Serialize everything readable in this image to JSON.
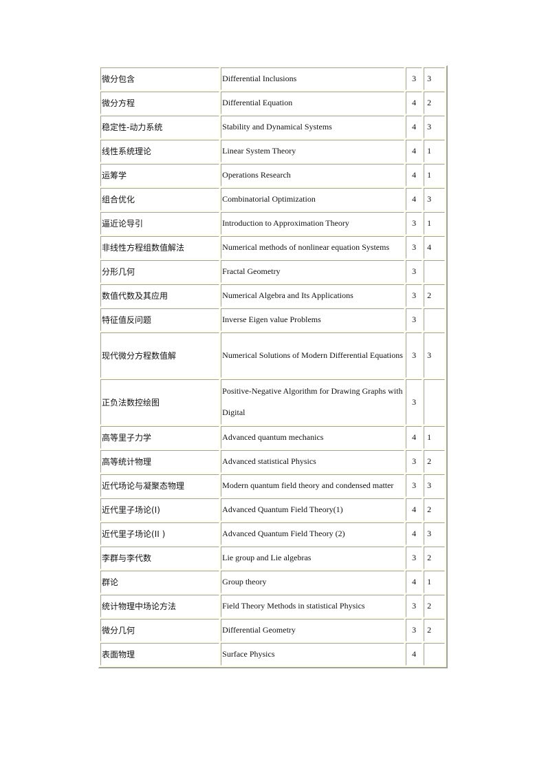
{
  "table": {
    "rows": [
      {
        "cn": "微分包含",
        "en": "Differential  Inclusions",
        "a": "3",
        "b": "3"
      },
      {
        "cn": "微分方程",
        "en": "Differential  Equation",
        "a": "4",
        "b": "2"
      },
      {
        "cn": "稳定性-动力系统",
        "en": "Stability and Dynamical  Systems",
        "a": "4",
        "b": "3"
      },
      {
        "cn": "线性系统理论",
        "en": "Linear  System  Theory",
        "a": "4",
        "b": "1"
      },
      {
        "cn": "运筹学",
        "en": "Operations  Research",
        "a": "4",
        "b": "1"
      },
      {
        "cn": "组合优化",
        "en": "Combinatorial  Optimization",
        "a": "4",
        "b": "3"
      },
      {
        "cn": "逼近论导引",
        "en": "Introduction  to  Approximation  Theory",
        "a": "3",
        "b": "1"
      },
      {
        "cn": "非线性方程组数值解法",
        "en": "Numerical  methods of nonlinear  equation  Systems",
        "a": "3",
        "b": "4"
      },
      {
        "cn": "分形几何",
        "en": "Fractal  Geometry",
        "a": "3",
        "b": ""
      },
      {
        "cn": "数值代数及其应用",
        "en": "Numerical  Algebra and Its  Applications",
        "a": "3",
        "b": "2"
      },
      {
        "cn": "特征值反问题",
        "en": "Inverse Eigen  value  Problems",
        "a": "3",
        "b": ""
      },
      {
        "cn": "现代微分方程数值解",
        "en": "Numerical  Solutions of  Modern  Differential Equations",
        "a": "3",
        "b": "3",
        "tall": true
      },
      {
        "cn": "正负法数控绘图",
        "en": "Positive-Negative  Algorithm  for Drawing  Graphs with Digital",
        "a": "3",
        "b": "",
        "tall": true
      },
      {
        "cn": "高等里子力学",
        "en": "Advanced  quantum  mechanics",
        "a": "4",
        "b": "1"
      },
      {
        "cn": "高等统计物理",
        "en": "Advanced  statistical  Physics",
        "a": "3",
        "b": "2"
      },
      {
        "cn": "近代场论与凝聚态物理",
        "en": "Modern  quantum  field  theory and condensed  matter",
        "a": "3",
        "b": "3"
      },
      {
        "cn": "近代里子场论(I)",
        "en": "Advanced  Quantum  Field  Theory(1)",
        "a": "4",
        "b": "2"
      },
      {
        "cn": "近代里子场论(II )",
        "en": "Advanced  Quantum  Field  Theory  (2)",
        "a": "4",
        "b": "3"
      },
      {
        "cn": "李群与李代数",
        "en": "Lie  group and Lie  algebras",
        "a": "3",
        "b": "2"
      },
      {
        "cn": "群论",
        "en": "Group theory",
        "a": "4",
        "b": "1"
      },
      {
        "cn": "统计物理中场论方法",
        "en": "Field  Theory Methods  in  statistical  Physics",
        "a": "3",
        "b": "2"
      },
      {
        "cn": "微分几何",
        "en": "Differential  Geometry",
        "a": "3",
        "b": "2"
      },
      {
        "cn": "表面物理",
        "en": "Surface  Physics",
        "a": "4",
        "b": ""
      }
    ]
  }
}
